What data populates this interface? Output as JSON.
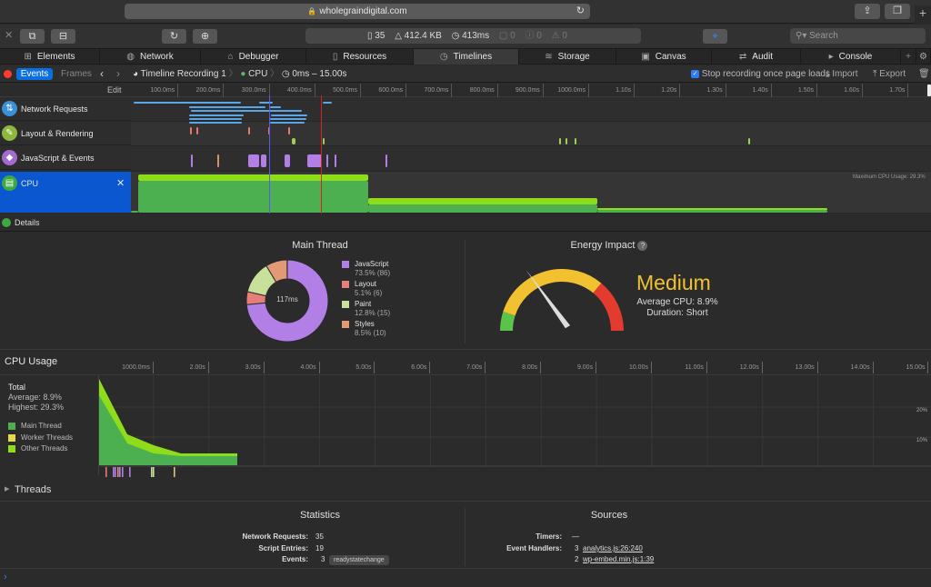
{
  "browser": {
    "url": "wholegraindigital.com",
    "page_stats": {
      "resources": "35",
      "size": "412.4 KB",
      "load_time": "413ms",
      "logs": "0",
      "errors": "0",
      "warnings": "0"
    },
    "search_placeholder": "Search"
  },
  "tabs": [
    {
      "label": "Elements",
      "icon": "elements-icon"
    },
    {
      "label": "Network",
      "icon": "network-icon"
    },
    {
      "label": "Debugger",
      "icon": "debugger-icon"
    },
    {
      "label": "Resources",
      "icon": "resources-icon"
    },
    {
      "label": "Timelines",
      "icon": "clock-icon",
      "active": true
    },
    {
      "label": "Storage",
      "icon": "storage-icon"
    },
    {
      "label": "Canvas",
      "icon": "canvas-icon"
    },
    {
      "label": "Audit",
      "icon": "audit-icon"
    },
    {
      "label": "Console",
      "icon": "console-icon"
    }
  ],
  "subbar": {
    "events_label": "Events",
    "frames_label": "Frames",
    "breadcrumb": [
      "Timeline Recording 1",
      "CPU",
      "0ms – 15.00s"
    ],
    "stop_recording_label": "Stop recording once page loads",
    "stop_recording_checked": true,
    "import_label": "Import",
    "export_label": "Export"
  },
  "timeline": {
    "edit_label": "Edit",
    "ruler_ticks": [
      "100.0ms",
      "200.0ms",
      "300.0ms",
      "400.0ms",
      "500.0ms",
      "600.0ms",
      "700.0ms",
      "800.0ms",
      "900.0ms",
      "1000.0ms",
      "1.10s",
      "1.20s",
      "1.30s",
      "1.40s",
      "1.50s",
      "1.60s",
      "1.70s"
    ],
    "rows": [
      {
        "label": "Network Requests",
        "color": "#3b8fd6"
      },
      {
        "label": "Layout & Rendering",
        "color": "#8cb83c"
      },
      {
        "label": "JavaScript & Events",
        "color": "#a36bd0"
      },
      {
        "label": "CPU",
        "color": "#3fa83f",
        "selected": true
      }
    ],
    "max_cpu_label": "Maximum CPU Usage: 29.3%",
    "details_label": "Details"
  },
  "main_thread": {
    "title": "Main Thread",
    "center_label": "117ms",
    "segments": [
      {
        "name": "JavaScript",
        "value": "73.5% (86)",
        "percent": 73.5,
        "color": "#b27fe6"
      },
      {
        "name": "Layout",
        "value": "5.1% (6)",
        "percent": 5.1,
        "color": "#e67f7a"
      },
      {
        "name": "Paint",
        "value": "12.8% (15)",
        "percent": 12.8,
        "color": "#c8e09a"
      },
      {
        "name": "Styles",
        "value": "8.5% (10)",
        "percent": 8.5,
        "color": "#e29a76"
      }
    ]
  },
  "energy": {
    "title": "Energy Impact",
    "level": "Medium",
    "average_cpu": "Average CPU: 8.9%",
    "duration": "Duration: Short",
    "gauge_value": 0.3
  },
  "cpu_usage": {
    "title": "CPU Usage",
    "total_label": "Total",
    "average": "Average: 8.9%",
    "highest": "Highest: 29.3%",
    "legend": [
      {
        "label": "Main Thread",
        "color": "#4caf50"
      },
      {
        "label": "Worker Threads",
        "color": "#e6d84a"
      },
      {
        "label": "Other Threads",
        "color": "#8fdc1a"
      }
    ],
    "ticks": [
      "1000.0ms",
      "2.00s",
      "3.00s",
      "4.00s",
      "5.00s",
      "6.00s",
      "7.00s",
      "8.00s",
      "9.00s",
      "10.00s",
      "11.00s",
      "12.00s",
      "13.00s",
      "14.00s",
      "15.00s"
    ],
    "y_labels": [
      "20%",
      "10%"
    ]
  },
  "threads_label": "Threads",
  "statistics": {
    "title": "Statistics",
    "rows": [
      {
        "key": "Network Requests:",
        "value": "35"
      },
      {
        "key": "Script Entries:",
        "value": "19"
      },
      {
        "key": "Events:",
        "value": "3",
        "pill": "readystatechange"
      }
    ]
  },
  "sources": {
    "title": "Sources",
    "timers_key": "Timers:",
    "timers_value": "—",
    "handlers_key": "Event Handlers:",
    "handlers": [
      {
        "count": "3",
        "link": "analytics.js:26:240"
      },
      {
        "count": "2",
        "link": "wp-embed.min.js:1:39"
      }
    ]
  }
}
